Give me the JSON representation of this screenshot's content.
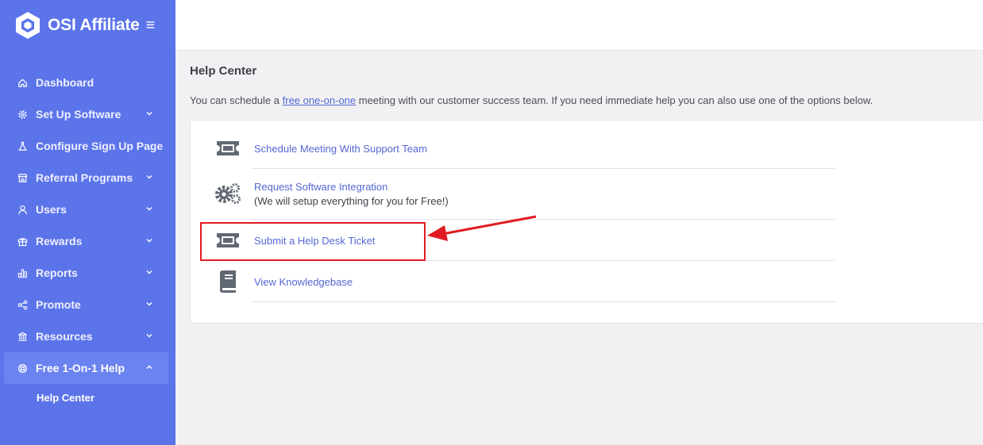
{
  "brand": {
    "name": "OSI Affiliate"
  },
  "sidebar": {
    "items": [
      {
        "label": "Dashboard",
        "icon": "home-icon",
        "expandable": false
      },
      {
        "label": "Set Up Software",
        "icon": "gear-icon",
        "expandable": true
      },
      {
        "label": "Configure Sign Up Page",
        "icon": "flask-icon",
        "expandable": false
      },
      {
        "label": "Referral Programs",
        "icon": "store-icon",
        "expandable": true
      },
      {
        "label": "Users",
        "icon": "user-icon",
        "expandable": true
      },
      {
        "label": "Rewards",
        "icon": "gift-icon",
        "expandable": true
      },
      {
        "label": "Reports",
        "icon": "bar-chart-icon",
        "expandable": true
      },
      {
        "label": "Promote",
        "icon": "share-icon",
        "expandable": true
      },
      {
        "label": "Resources",
        "icon": "bank-icon",
        "expandable": true
      },
      {
        "label": "Free 1-On-1 Help",
        "icon": "support-icon",
        "expandable": true,
        "active": true
      }
    ],
    "sub_items": [
      {
        "label": "Help Center"
      }
    ]
  },
  "main": {
    "title": "Help Center",
    "intro_before": "You can schedule a ",
    "intro_link": "free one-on-one",
    "intro_after": " meeting with our customer success team. If you need immediate help you can also use one of the options below.",
    "options": [
      {
        "label": "Schedule Meeting With Support Team",
        "icon": "ticket-icon"
      },
      {
        "label": "Request Software Integration",
        "sub": "(We will setup everything for you for Free!)",
        "icon": "gears-icon"
      },
      {
        "label": "Submit a Help Desk Ticket",
        "icon": "ticket-icon"
      },
      {
        "label": "View Knowledgebase",
        "icon": "book-icon"
      }
    ]
  },
  "colors": {
    "sidebar": "#5c74ea",
    "link": "#5468d4",
    "annotation": "#e11b22"
  }
}
